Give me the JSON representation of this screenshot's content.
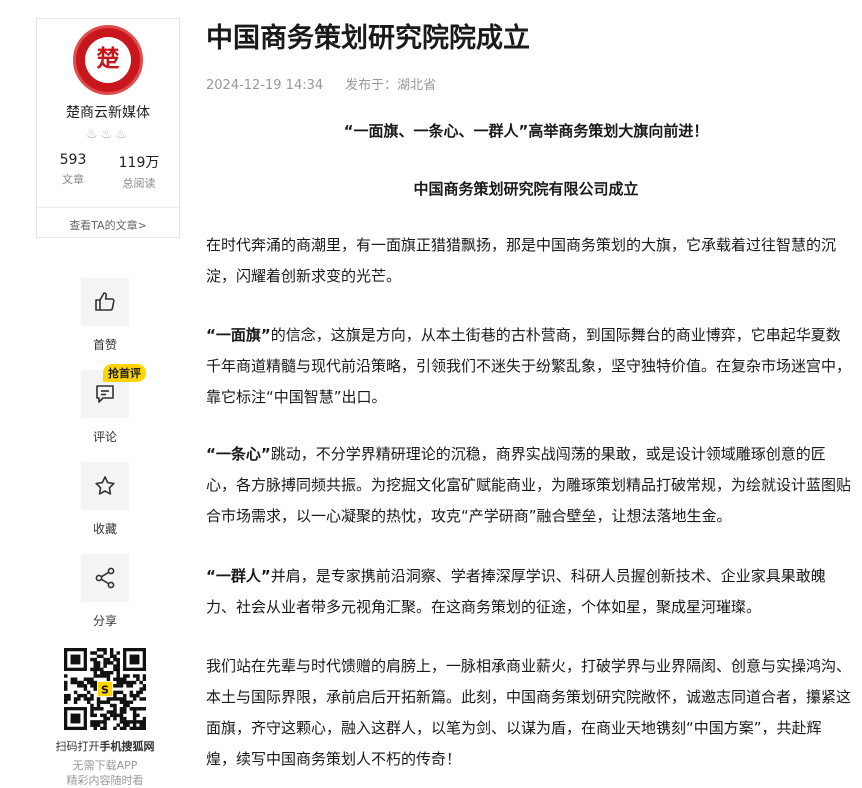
{
  "author": {
    "logo_glyph": "楚",
    "name": "楚商云新媒体",
    "ranks": "♨♨♨",
    "stats": [
      {
        "value": "593",
        "label": "文章"
      },
      {
        "value": "119万",
        "label": "总阅读"
      }
    ],
    "view_articles": "查看TA的文章>"
  },
  "actions": {
    "like": {
      "label": "首赞"
    },
    "comment": {
      "label": "评论",
      "badge": "抢首评"
    },
    "favorite": {
      "label": "收藏"
    },
    "share": {
      "label": "分享"
    }
  },
  "qr": {
    "caption_prefix": "扫码打开",
    "caption_bold": "手机搜狐网",
    "sub1": "无需下载APP",
    "sub2": "精彩内容随时看"
  },
  "article": {
    "title": "中国商务策划研究院院成立",
    "date": "2024-12-19 14:34",
    "published_in": "发布于：湖北省",
    "subtitle1": "“一面旗、一条心、一群人”高举商务策划大旗向前进！",
    "subtitle2": "中国商务策划研究院有限公司成立",
    "p1": "在时代奔涌的商潮里，有一面旗正猎猎飘扬，那是中国商务策划的大旗，它承载着过往智慧的沉淀，闪耀着创新求变的光芒。",
    "p2_bold": "“一面旗”",
    "p2": "的信念，这旗是方向，从本土街巷的古朴营商，到国际舞台的商业博弈，它串起华夏数千年商道精髓与现代前沿策略，引领我们不迷失于纷繁乱象，坚守独特价值。在复杂市场迷宫中，靠它标注“中国智慧”出口。",
    "p3_bold": "“一条心”",
    "p3": "跳动，不分学界精研理论的沉稳，商界实战闯荡的果敢，或是设计领域雕琢创意的匠心，各方脉搏同频共振。为挖掘文化富矿赋能商业，为雕琢策划精品打破常规，为绘就设计蓝图贴合市场需求，以一心凝聚的热忱，攻克“产学研商”融合壁垒，让想法落地生金。",
    "p4_bold": "“一群人”",
    "p4": "并肩，是专家携前沿洞察、学者捧深厚学识、科研人员握创新技术、企业家具果敢魄力、社会从业者带多元视角汇聚。在这商务策划的征途，个体如星，聚成星河璀璨。",
    "p5": "我们站在先辈与时代馈赠的肩膀上，一脉相承商业薪火，打破学界与业界隔阂、创意与实操鸿沟、本土与国际界限，承前启后开拓新篇。此刻，中国商务策划研究院敞怀，诚邀志同道合者，攥紧这面旗，齐守这颗心，融入这群人，以笔为剑、以谋为盾，在商业天地镌刻“中国方案”，共赴辉煌，续写中国商务策划人不朽的传奇！"
  },
  "colors": {
    "brand_red": "#c8161d",
    "badge_yellow": "#ffd400",
    "meta_gray": "#999999"
  }
}
